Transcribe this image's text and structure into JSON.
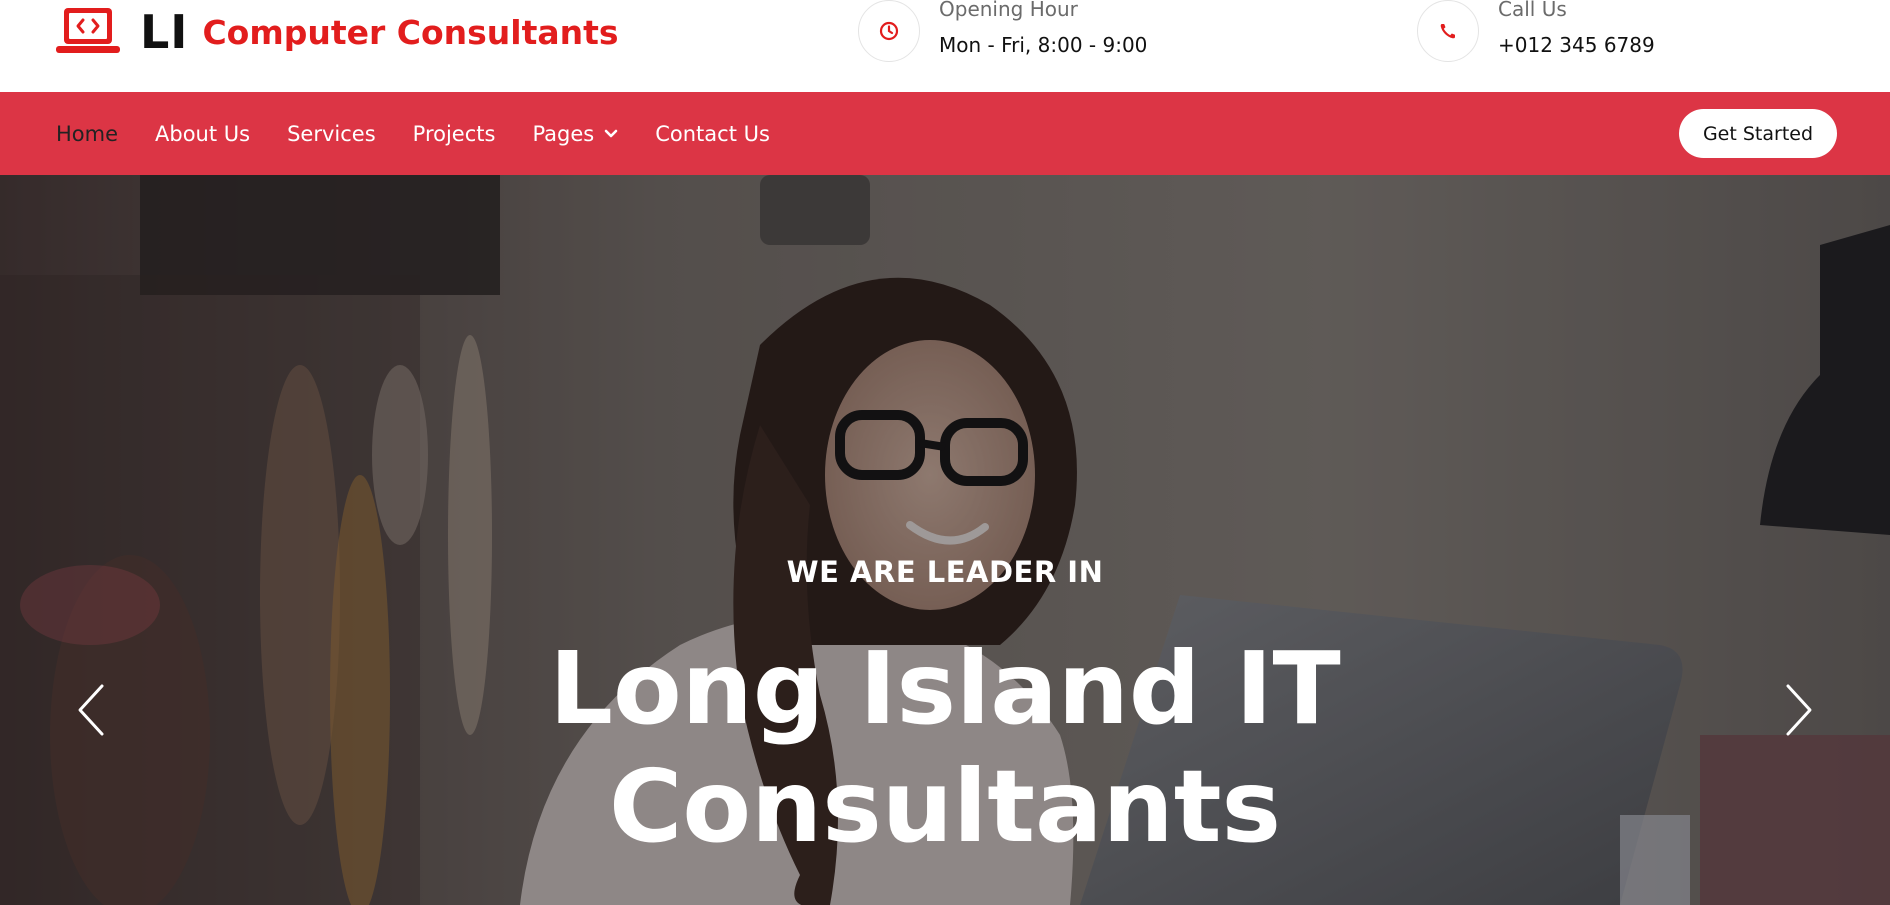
{
  "brand": {
    "short": "LI",
    "name": "Computer Consultants",
    "icon": "laptop-code-icon",
    "accent_color": "#e21d1d"
  },
  "info": {
    "hours": {
      "label": "Opening Hour",
      "value": "Mon - Fri, 8:00 - 9:00",
      "icon": "clock-icon"
    },
    "call": {
      "label": "Call Us",
      "value": "+012 345 6789",
      "icon": "phone-icon"
    }
  },
  "nav": {
    "items": [
      {
        "label": "Home",
        "active": true
      },
      {
        "label": "About Us"
      },
      {
        "label": "Services"
      },
      {
        "label": "Projects"
      },
      {
        "label": "Pages",
        "dropdown": true
      },
      {
        "label": "Contact Us"
      }
    ],
    "cta": "Get Started",
    "bar_color": "#dc3545"
  },
  "hero": {
    "eyebrow": "WE ARE LEADER IN",
    "headline_line1": "Long Island IT",
    "headline_line2": "Consultants",
    "prev_icon": "chevron-left-icon",
    "next_icon": "chevron-right-icon"
  }
}
